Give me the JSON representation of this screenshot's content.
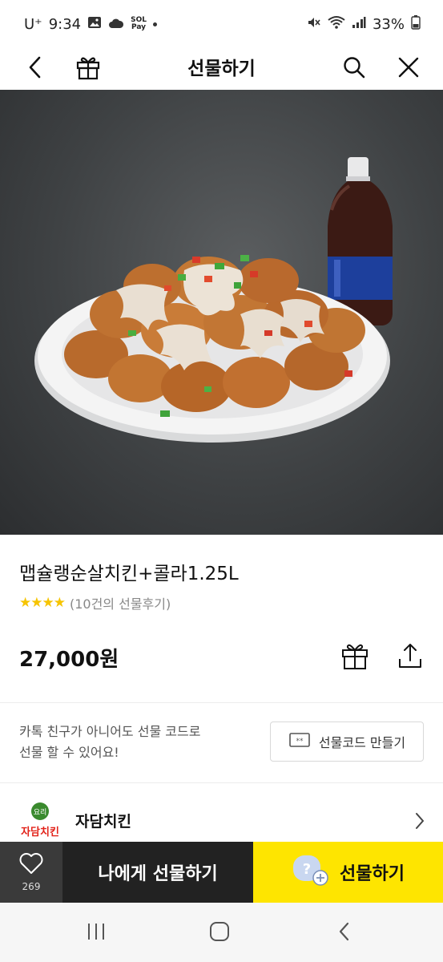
{
  "status_bar": {
    "carrier": "U⁺",
    "time": "9:34",
    "pay_label_top": "SOL",
    "pay_label_bottom": "Pay",
    "battery": "33%",
    "icons": [
      "image-icon",
      "cloud-icon",
      "mute-icon",
      "wifi-icon",
      "signal-icon",
      "battery-icon"
    ]
  },
  "header": {
    "title": "선물하기",
    "icons": [
      "back-icon",
      "gift-icon",
      "search-icon",
      "close-icon"
    ]
  },
  "product": {
    "name": "맵슐랭순살치킨+콜라1.25L",
    "stars": "★★★★",
    "review_count": "(10건의 선물후기)",
    "price": "27,000원"
  },
  "gift_code": {
    "text_line1": "카톡 친구가 아니어도 선물 코드로",
    "text_line2": "선물 할 수 있어요!",
    "button_label": "선물코드 만들기"
  },
  "store": {
    "name": "자담치킨",
    "logo_text": "자담치킨",
    "logo_badge": "요리"
  },
  "bottom_bar": {
    "like_count": "269",
    "self_gift_label": "나에게 선물하기",
    "gift_label": "선물하기"
  },
  "colors": {
    "accent": "#fee500",
    "dark": "#222222",
    "star": "#f6c400",
    "logo_red": "#e2231a",
    "logo_green": "#3a8a2e"
  }
}
